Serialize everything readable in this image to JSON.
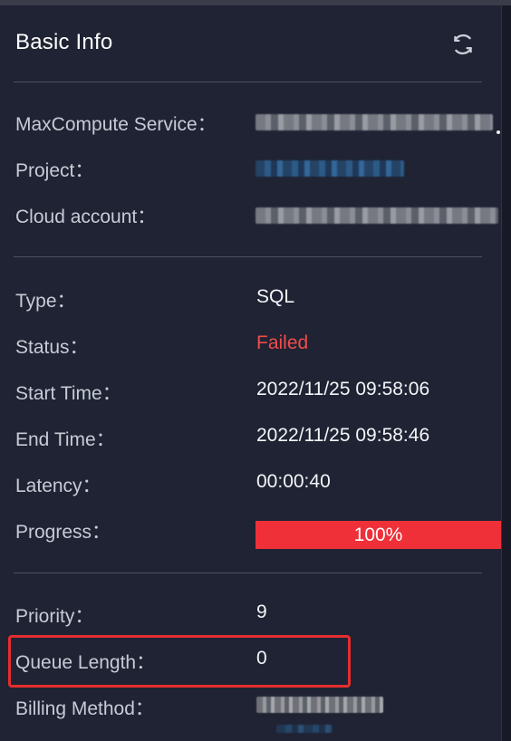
{
  "panel": {
    "title": "Basic Info",
    "refresh_icon": "refresh-icon"
  },
  "section1": {
    "maxcompute_service_label": "MaxCompute Service：",
    "project_label": "Project：",
    "cloud_account_label": "Cloud account："
  },
  "section2": {
    "type_label": "Type：",
    "type_value": "SQL",
    "status_label": "Status：",
    "status_value": "Failed",
    "start_time_label": "Start Time：",
    "start_time_value": "2022/11/25 09:58:06",
    "end_time_label": "End Time：",
    "end_time_value": "2022/11/25 09:58:46",
    "latency_label": "Latency：",
    "latency_value": "00:00:40",
    "progress_label": "Progress：",
    "progress_value": "100%",
    "progress_fraction": 1.0
  },
  "section3": {
    "priority_label": "Priority：",
    "priority_value": "9",
    "queue_length_label": "Queue Length：",
    "queue_length_value": "0",
    "billing_method_label": "Billing Method："
  },
  "colors": {
    "background": "#1f2333",
    "failed": "#f24b4b",
    "progress": "#ef3039",
    "highlight": "#e52d2f"
  }
}
